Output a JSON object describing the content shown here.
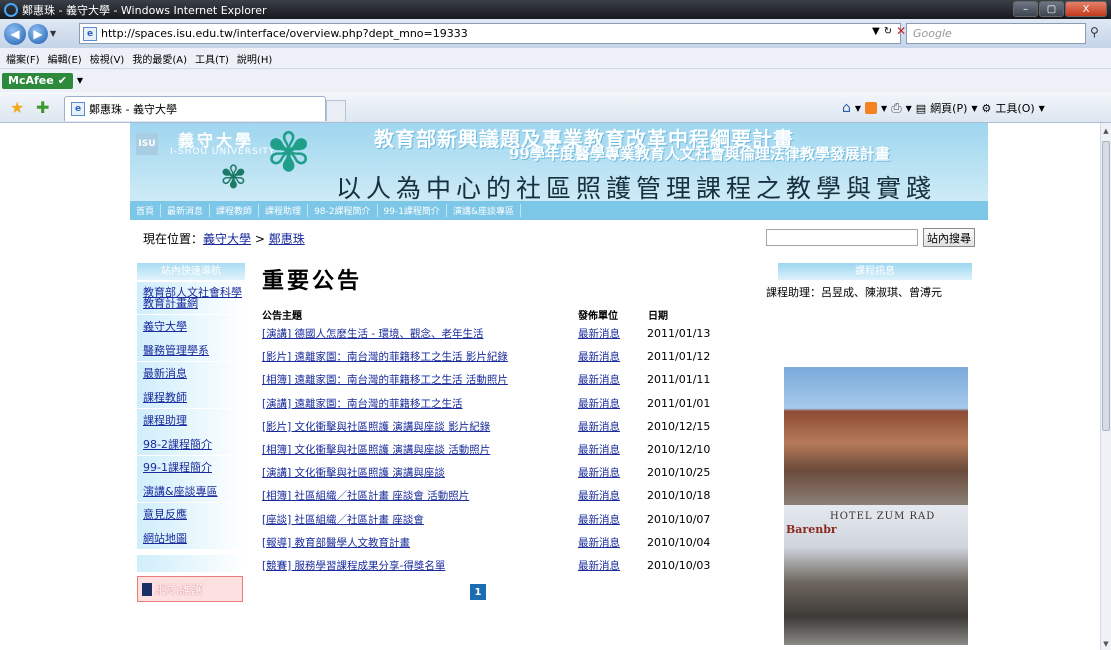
{
  "window": {
    "title": "鄭惠珠 - 義守大學 - Windows Internet Explorer",
    "min_glyph": "–",
    "max_glyph": "▢",
    "close_glyph": "X"
  },
  "address": {
    "url": "http://spaces.isu.edu.tw/interface/overview.php?dept_mno=19333",
    "search_placeholder": "Google"
  },
  "menu": {
    "items": [
      "檔案(F)",
      "編輯(E)",
      "檢視(V)",
      "我的最愛(A)",
      "工具(T)",
      "說明(H)"
    ]
  },
  "toolbar": {
    "mcafee_label": "McAfee"
  },
  "tabs": {
    "active_label": "鄭惠珠 - 義守大學"
  },
  "commandbar": {
    "page_label": "網頁(P)",
    "tools_label": "工具(O)"
  },
  "banner": {
    "university_name": "義守大學",
    "university_en": "I-SHOU UNIVERSITY",
    "logo_text": "ISU",
    "plan_title": "教育部新興議題及專業教育改革中程綱要計畫",
    "plan_subtitle": "99學年度醫學專業教育人文社會與倫理法律教學發展計畫",
    "course_title": "以人為中心的社區照護管理課程之教學與實踐",
    "nav": [
      "首頁",
      "最新消息",
      "課程教師",
      "課程助理",
      "98-2課程簡介",
      "99-1課程簡介",
      "演講&座談專區"
    ]
  },
  "breadcrumb": {
    "prefix": "現在位置：",
    "parent": "義守大學",
    "separator": " > ",
    "current": "鄭惠珠"
  },
  "site_search": {
    "value": "",
    "button_label": "站內搜尋"
  },
  "sidebar": {
    "header": "站內快速導航",
    "items": [
      "教育部人文社會科學教育計畫網",
      "義守大學",
      "醫務管理學系",
      "最新消息",
      "課程教師",
      "課程助理",
      "98-2課程簡介",
      "99-1課程簡介",
      "演講&座談專區",
      "意見反應",
      "網站地圖"
    ],
    "maintenance_label": "網站維護"
  },
  "notices": {
    "title": "重要公告",
    "col_subject": "公告主題",
    "col_unit": "發佈單位",
    "col_date": "日期",
    "rows": [
      {
        "subject": "[演講] 德國人怎麼生活 - 環境、觀念、老年生活",
        "unit": "最新消息",
        "date": "2011/01/13"
      },
      {
        "subject": "[影片] 遠離家園：南台灣的菲籍移工之生活 影片紀錄",
        "unit": "最新消息",
        "date": "2011/01/12"
      },
      {
        "subject": "[相簿] 遠離家園：南台灣的菲籍移工之生活 活動照片",
        "unit": "最新消息",
        "date": "2011/01/11"
      },
      {
        "subject": "[演講] 遠離家園：南台灣的菲籍移工之生活",
        "unit": "最新消息",
        "date": "2011/01/01"
      },
      {
        "subject": "[影片] 文化衝擊與社區照護 演講與座談 影片紀錄",
        "unit": "最新消息",
        "date": "2010/12/15"
      },
      {
        "subject": "[相簿] 文化衝擊與社區照護 演講與座談 活動照片",
        "unit": "最新消息",
        "date": "2010/12/10"
      },
      {
        "subject": "[演講] 文化衝擊與社區照護 演講與座談",
        "unit": "最新消息",
        "date": "2010/10/25"
      },
      {
        "subject": "[相簿] 社區組織／社區計畫 座談會 活動照片",
        "unit": "最新消息",
        "date": "2010/10/18"
      },
      {
        "subject": "[座談] 社區組織／社區計畫 座談會",
        "unit": "最新消息",
        "date": "2010/10/07"
      },
      {
        "subject": "[報導] 教育部醫學人文教育計畫",
        "unit": "最新消息",
        "date": "2010/10/04"
      },
      {
        "subject": "[競賽] 服務學習課程成果分享-得獎名單",
        "unit": "最新消息",
        "date": "2010/10/03"
      }
    ],
    "page": "1"
  },
  "course_info": {
    "header": "課程訊息",
    "assistants": "課程助理：呂昱成、陳淑琪、曾溥元"
  },
  "photos": {
    "sign1": "HOTEL ZUM RAD",
    "sign2": "Barenbr"
  }
}
